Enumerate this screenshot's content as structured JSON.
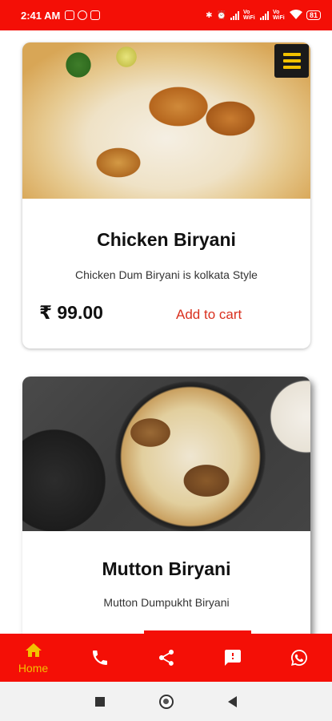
{
  "status_bar": {
    "time": "2:41 AM",
    "battery": "81",
    "network_labels": [
      "Vo WiFi",
      "Vo WiFi"
    ]
  },
  "menu": {
    "icon": "hamburger-menu-icon"
  },
  "products": [
    {
      "title": "Chicken Biryani",
      "description": "Chicken Dum Biryani is kolkata Style",
      "price": "₹ 99.00",
      "cart_label": "Add to cart"
    },
    {
      "title": "Mutton Biryani",
      "description": "Mutton Dumpukht Biryani"
    }
  ],
  "bottom_nav": {
    "home_label": "Home",
    "items": [
      "home-icon",
      "phone-icon",
      "share-icon",
      "feedback-icon",
      "whatsapp-icon"
    ]
  },
  "colors": {
    "brand_red": "#f40f06",
    "accent_yellow": "#f2c200",
    "cart_red": "#d9301e"
  }
}
